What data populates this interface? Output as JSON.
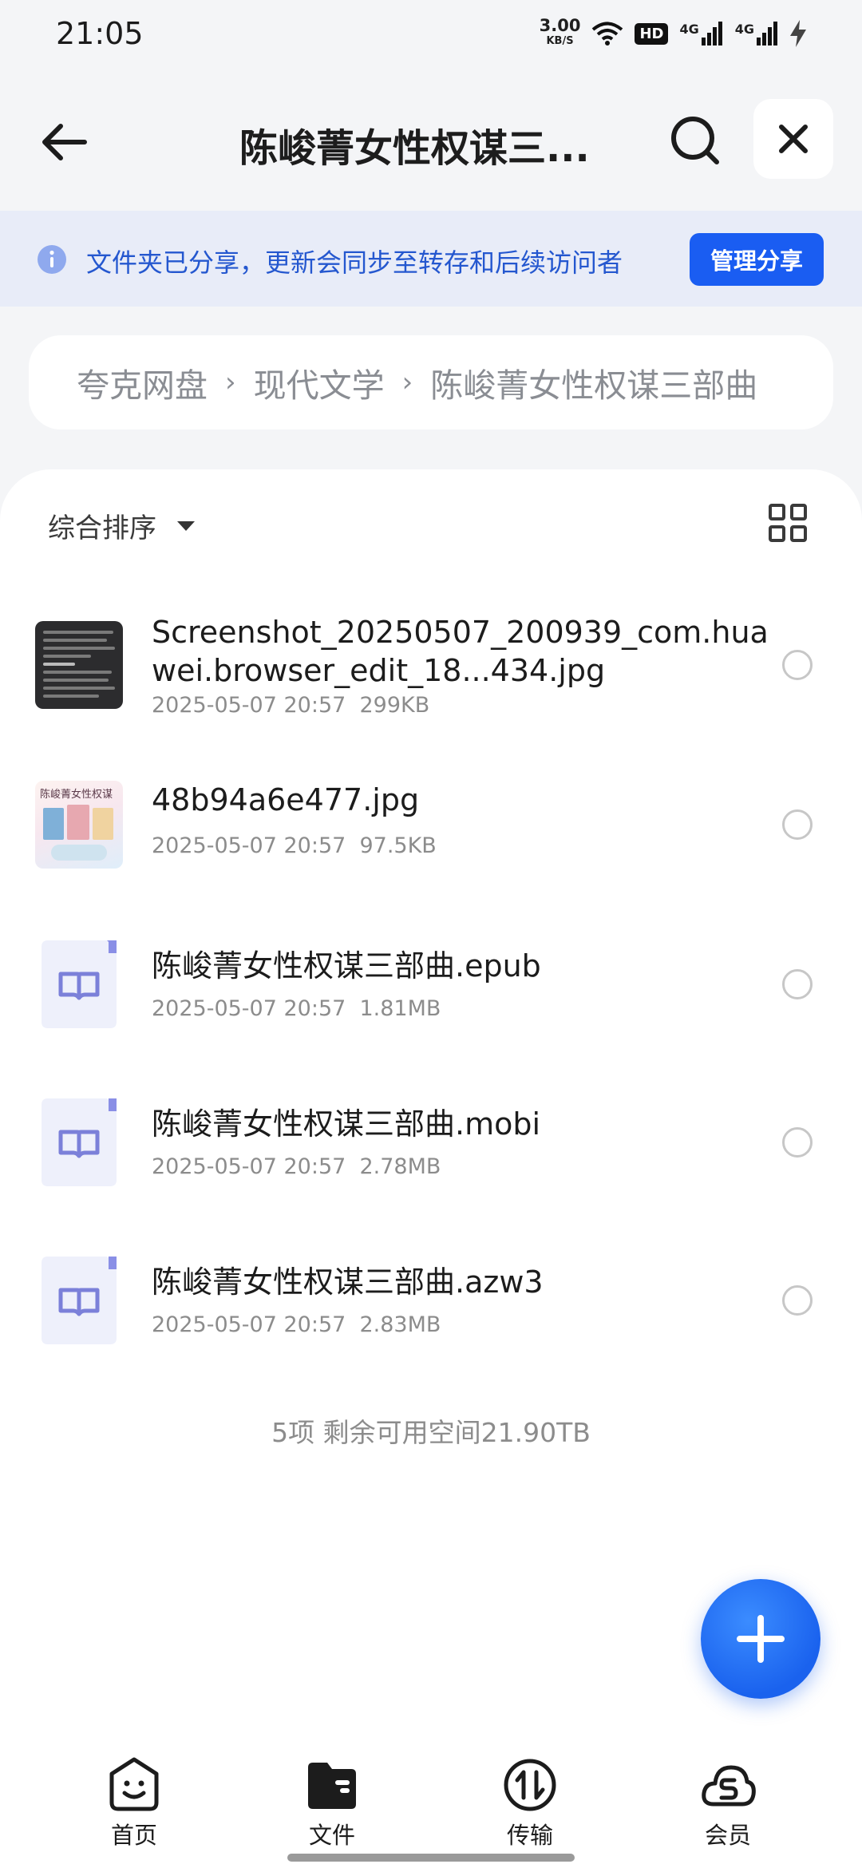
{
  "status_bar": {
    "time": "21:05",
    "speed_value": "3.00",
    "speed_unit": "KB/S",
    "hd_badge": "HD",
    "network_1": "4G",
    "network_2": "4G"
  },
  "header": {
    "title": "陈峻菁女性权谋三...",
    "back_icon": "arrow-left-icon",
    "search_icon": "search-icon",
    "close_icon": "close-icon"
  },
  "share_banner": {
    "text": "文件夹已分享，更新会同步至转存和后续访问者",
    "button_label": "管理分享",
    "accent": "#1a5df2"
  },
  "breadcrumb": {
    "items": [
      "夸克网盘",
      "现代文学",
      "陈峻菁女性权谋三部曲"
    ],
    "separator": "›"
  },
  "list": {
    "sort_label": "综合排序",
    "files": [
      {
        "name": "Screenshot_20250507_200939_com.huawei.browser_edit_18...434.jpg",
        "date": "2025-05-07 20:57",
        "size": "299KB",
        "icon": "image-thumbnail"
      },
      {
        "name": "48b94a6e477.jpg",
        "date": "2025-05-07 20:57",
        "size": "97.5KB",
        "icon": "book-cover-thumbnail",
        "cover_title": "陈峻菁女性权谋"
      },
      {
        "name": "陈峻菁女性权谋三部曲.epub",
        "date": "2025-05-07 20:57",
        "size": "1.81MB",
        "icon": "book-file-icon"
      },
      {
        "name": "陈峻菁女性权谋三部曲.mobi",
        "date": "2025-05-07 20:57",
        "size": "2.78MB",
        "icon": "book-file-icon"
      },
      {
        "name": "陈峻菁女性权谋三部曲.azw3",
        "date": "2025-05-07 20:57",
        "size": "2.83MB",
        "icon": "book-file-icon"
      }
    ],
    "summary": "5项 剩余可用空间21.90TB"
  },
  "bottom_nav": {
    "items": [
      {
        "label": "首页",
        "icon": "smile-home-icon"
      },
      {
        "label": "文件",
        "icon": "folder-icon"
      },
      {
        "label": "传输",
        "icon": "transfer-icon"
      },
      {
        "label": "会员",
        "icon": "vip-cloud-icon"
      }
    ]
  }
}
